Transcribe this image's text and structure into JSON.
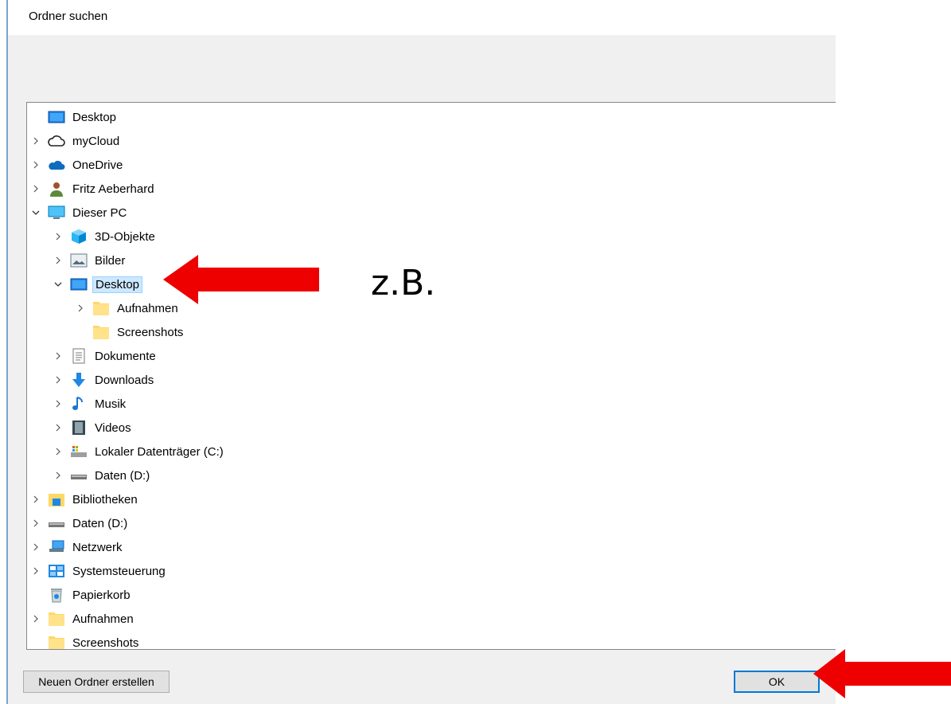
{
  "dialog": {
    "title": "Ordner suchen",
    "new_folder_button": "Neuen Ordner erstellen",
    "ok_button": "OK"
  },
  "tree": [
    {
      "label": "Desktop",
      "level": 0,
      "expander": "none",
      "icon": "desktop-icon"
    },
    {
      "label": "myCloud",
      "level": 0,
      "expander": "collapsed",
      "icon": "cloud-outline-icon"
    },
    {
      "label": "OneDrive",
      "level": 0,
      "expander": "collapsed",
      "icon": "onedrive-icon"
    },
    {
      "label": "Fritz Aeberhard",
      "level": 0,
      "expander": "collapsed",
      "icon": "user-icon"
    },
    {
      "label": "Dieser PC",
      "level": 0,
      "expander": "expanded",
      "icon": "computer-icon"
    },
    {
      "label": "3D-Objekte",
      "level": 1,
      "expander": "collapsed",
      "icon": "3d-objects-icon"
    },
    {
      "label": "Bilder",
      "level": 1,
      "expander": "collapsed",
      "icon": "pictures-icon"
    },
    {
      "label": "Desktop",
      "level": 1,
      "expander": "expanded",
      "icon": "desktop-icon",
      "selected": true
    },
    {
      "label": "Aufnahmen",
      "level": 2,
      "expander": "collapsed",
      "icon": "folder-icon"
    },
    {
      "label": "Screenshots",
      "level": 2,
      "expander": "none",
      "icon": "folder-icon"
    },
    {
      "label": "Dokumente",
      "level": 1,
      "expander": "collapsed",
      "icon": "documents-icon"
    },
    {
      "label": "Downloads",
      "level": 1,
      "expander": "collapsed",
      "icon": "download-icon"
    },
    {
      "label": "Musik",
      "level": 1,
      "expander": "collapsed",
      "icon": "music-icon"
    },
    {
      "label": "Videos",
      "level": 1,
      "expander": "collapsed",
      "icon": "video-icon"
    },
    {
      "label": "Lokaler Datenträger (C:)",
      "level": 1,
      "expander": "collapsed",
      "icon": "system-drive-icon"
    },
    {
      "label": "Daten (D:)",
      "level": 1,
      "expander": "collapsed",
      "icon": "drive-icon"
    },
    {
      "label": "Bibliotheken",
      "level": 0,
      "expander": "collapsed",
      "icon": "libraries-icon"
    },
    {
      "label": "Daten (D:)",
      "level": 0,
      "expander": "collapsed",
      "icon": "drive-icon"
    },
    {
      "label": "Netzwerk",
      "level": 0,
      "expander": "collapsed",
      "icon": "network-icon"
    },
    {
      "label": "Systemsteuerung",
      "level": 0,
      "expander": "collapsed",
      "icon": "control-panel-icon"
    },
    {
      "label": "Papierkorb",
      "level": 0,
      "expander": "none",
      "icon": "recycle-bin-icon"
    },
    {
      "label": "Aufnahmen",
      "level": 0,
      "expander": "collapsed",
      "icon": "folder-icon"
    },
    {
      "label": "Screenshots",
      "level": 0,
      "expander": "none",
      "icon": "folder-icon"
    }
  ],
  "annotation": {
    "text": "z.B.",
    "arrow_color": "#ee0000"
  },
  "colors": {
    "selection_bg": "#cce8ff",
    "dialog_bg": "#f0f0f0",
    "focus_border": "#0078d7"
  }
}
